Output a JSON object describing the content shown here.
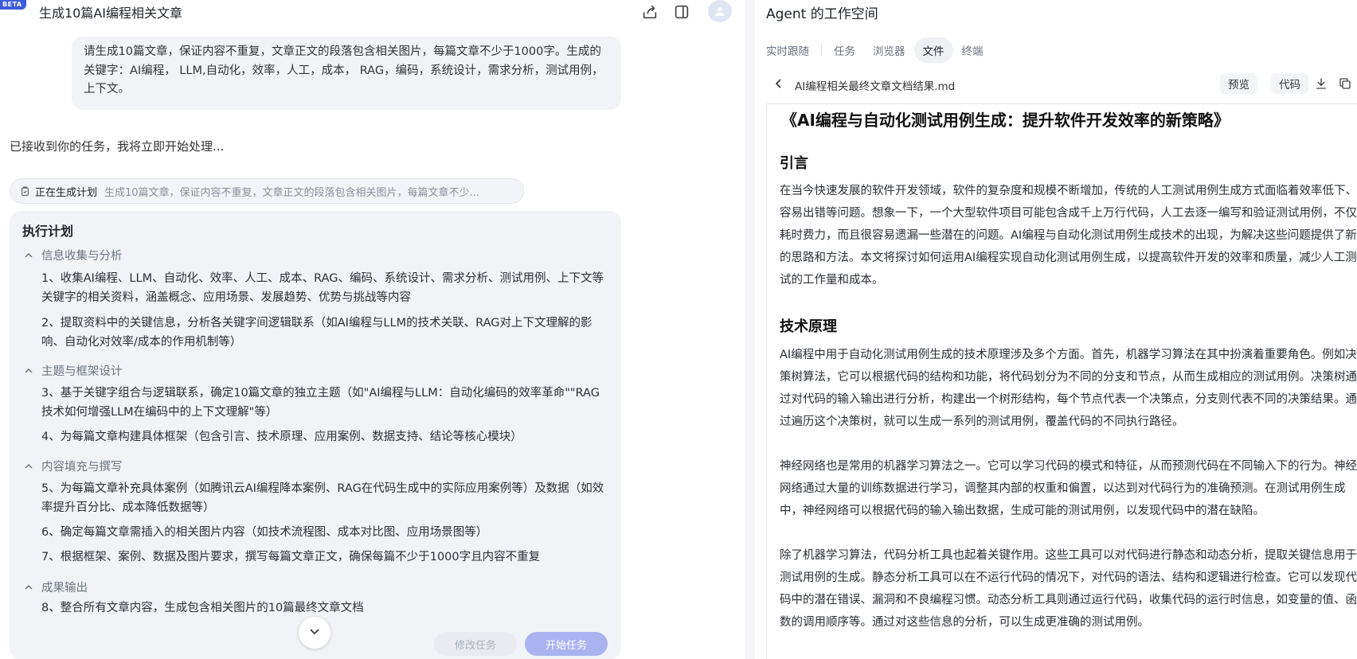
{
  "left": {
    "beta": "BETA",
    "title": "生成10篇AI编程相关文章",
    "user_message": "请生成10篇文章，保证内容不重复，文章正文的段落包含相关图片，每篇文章不少于1000字。生成的关键字：AI编程， LLM,自动化，效率，人工，成本， RAG，编码，系统设计，需求分析，测试用例，上下文。",
    "ack": "已接收到你的任务，我将立即开始处理...",
    "plan_pill_label": "正在生成计划",
    "plan_pill_desc": "生成10篇文章，保证内容不重复，文章正文的段落包含相关图片，每篇文章不少...",
    "plan_title": "执行计划",
    "phases": [
      {
        "title": "信息收集与分析",
        "steps": [
          "1、收集AI编程、LLM、自动化、效率、人工、成本、RAG、编码、系统设计、需求分析、测试用例、上下文等关键字的相关资料，涵盖概念、应用场景、发展趋势、优势与挑战等内容",
          "2、提取资料中的关键信息，分析各关键字间逻辑联系（如AI编程与LLM的技术关联、RAG对上下文理解的影响、自动化对效率/成本的作用机制等）"
        ]
      },
      {
        "title": "主题与框架设计",
        "steps": [
          "3、基于关键字组合与逻辑联系，确定10篇文章的独立主题（如\"AI编程与LLM：自动化编码的效率革命\"\"RAG技术如何增强LLM在编码中的上下文理解\"等）",
          "4、为每篇文章构建具体框架（包含引言、技术原理、应用案例、数据支持、结论等核心模块）"
        ]
      },
      {
        "title": "内容填充与撰写",
        "steps": [
          "5、为每篇文章补充具体案例（如腾讯云AI编程降本案例、RAG在代码生成中的实际应用案例等）及数据（如效率提升百分比、成本降低数据等）",
          "6、确定每篇文章需插入的相关图片内容（如技术流程图、成本对比图、应用场景图等）",
          "7、根据框架、案例、数据及图片要求，撰写每篇文章正文，确保每篇不少于1000字且内容不重复"
        ]
      },
      {
        "title": "成果输出",
        "steps": [
          "8、整合所有文章内容，生成包含相关图片的10篇最终文章文档"
        ]
      }
    ],
    "btn_edit": "修改任务",
    "btn_start": "开始任务"
  },
  "right": {
    "title": "Agent 的工作空间",
    "tabs": [
      "实时跟随",
      "任务",
      "浏览器",
      "文件",
      "终端"
    ],
    "active_tab": "文件",
    "file_name": "AI编程相关最终文章文档结果.md",
    "btn_preview": "预览",
    "btn_code": "代码",
    "doc": {
      "title": "《AI编程与自动化测试用例生成：提升软件开发效率的新策略》",
      "h_intro": "引言",
      "p_intro": "在当今快速发展的软件开发领域，软件的复杂度和规模不断增加，传统的人工测试用例生成方式面临着效率低下、容易出错等问题。想象一下，一个大型软件项目可能包含成千上万行代码，人工去逐一编写和验证测试用例，不仅耗时费力，而且很容易遗漏一些潜在的问题。AI编程与自动化测试用例生成技术的出现，为解决这些问题提供了新的思路和方法。本文将探讨如何运用AI编程实现自动化测试用例生成，以提高软件开发的效率和质量，减少人工测试的工作量和成本。",
      "h_tech": "技术原理",
      "p_tech1": "AI编程中用于自动化测试用例生成的技术原理涉及多个方面。首先，机器学习算法在其中扮演着重要角色。例如决策树算法，它可以根据代码的结构和功能，将代码划分为不同的分支和节点，从而生成相应的测试用例。决策树通过对代码的输入输出进行分析，构建出一个树形结构，每个节点代表一个决策点，分支则代表不同的决策结果。通过遍历这个决策树，就可以生成一系列的测试用例，覆盖代码的不同执行路径。",
      "p_tech2": "神经网络也是常用的机器学习算法之一。它可以学习代码的模式和特征，从而预测代码在不同输入下的行为。神经网络通过大量的训练数据进行学习，调整其内部的权重和偏置，以达到对代码行为的准确预测。在测试用例生成中，神经网络可以根据代码的输入输出数据，生成可能的测试用例，以发现代码中的潜在缺陷。",
      "p_tech3": "除了机器学习算法，代码分析工具也起着关键作用。这些工具可以对代码进行静态和动态分析，提取关键信息用于测试用例的生成。静态分析工具可以在不运行代码的情况下，对代码的语法、结构和逻辑进行检查。它可以发现代码中的潜在错误、漏洞和不良编程习惯。动态分析工具则通过运行代码，收集代码的运行时信息，如变量的值、函数的调用顺序等。通过对这些信息的分析，可以生成更准确的测试用例。"
    }
  }
}
